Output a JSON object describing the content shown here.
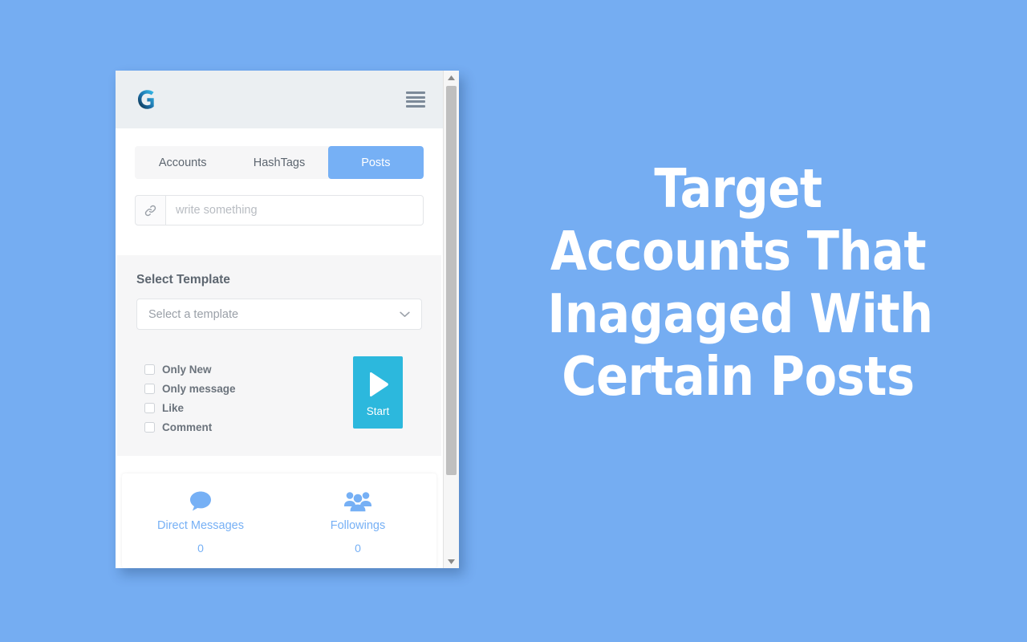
{
  "page": {
    "background_color": "#75adf2"
  },
  "headline": {
    "lines": [
      "Target",
      "Accounts That",
      "Inagaged With",
      "Certain Posts"
    ],
    "color": "#ffffff"
  },
  "app": {
    "header": {
      "logo_alt": "G",
      "menu_label": "menu"
    },
    "tabs": [
      {
        "label": "Accounts",
        "active": false
      },
      {
        "label": "HashTags",
        "active": false
      },
      {
        "label": "Posts",
        "active": true
      }
    ],
    "active_tab_color": "#76b0f5",
    "url_input": {
      "value": "",
      "placeholder": "write something",
      "addon_icon": "link-icon"
    },
    "template_section": {
      "title": "Select Template",
      "select": {
        "value": "Select a template",
        "placeholder": "Select a template"
      },
      "checkboxes": [
        {
          "label": "Only New",
          "checked": false
        },
        {
          "label": "Only message",
          "checked": false
        },
        {
          "label": "Like",
          "checked": false
        },
        {
          "label": "Comment",
          "checked": false
        }
      ],
      "start_button": {
        "label": "Start",
        "color": "#2cb8dd"
      }
    },
    "stats": [
      {
        "icon": "chat-bubble-icon",
        "label": "Direct Messages",
        "value": "0"
      },
      {
        "icon": "people-group-icon",
        "label": "Followings",
        "value": "0"
      }
    ],
    "scrollbar": {
      "up_label": "scroll up",
      "down_label": "scroll down"
    }
  }
}
